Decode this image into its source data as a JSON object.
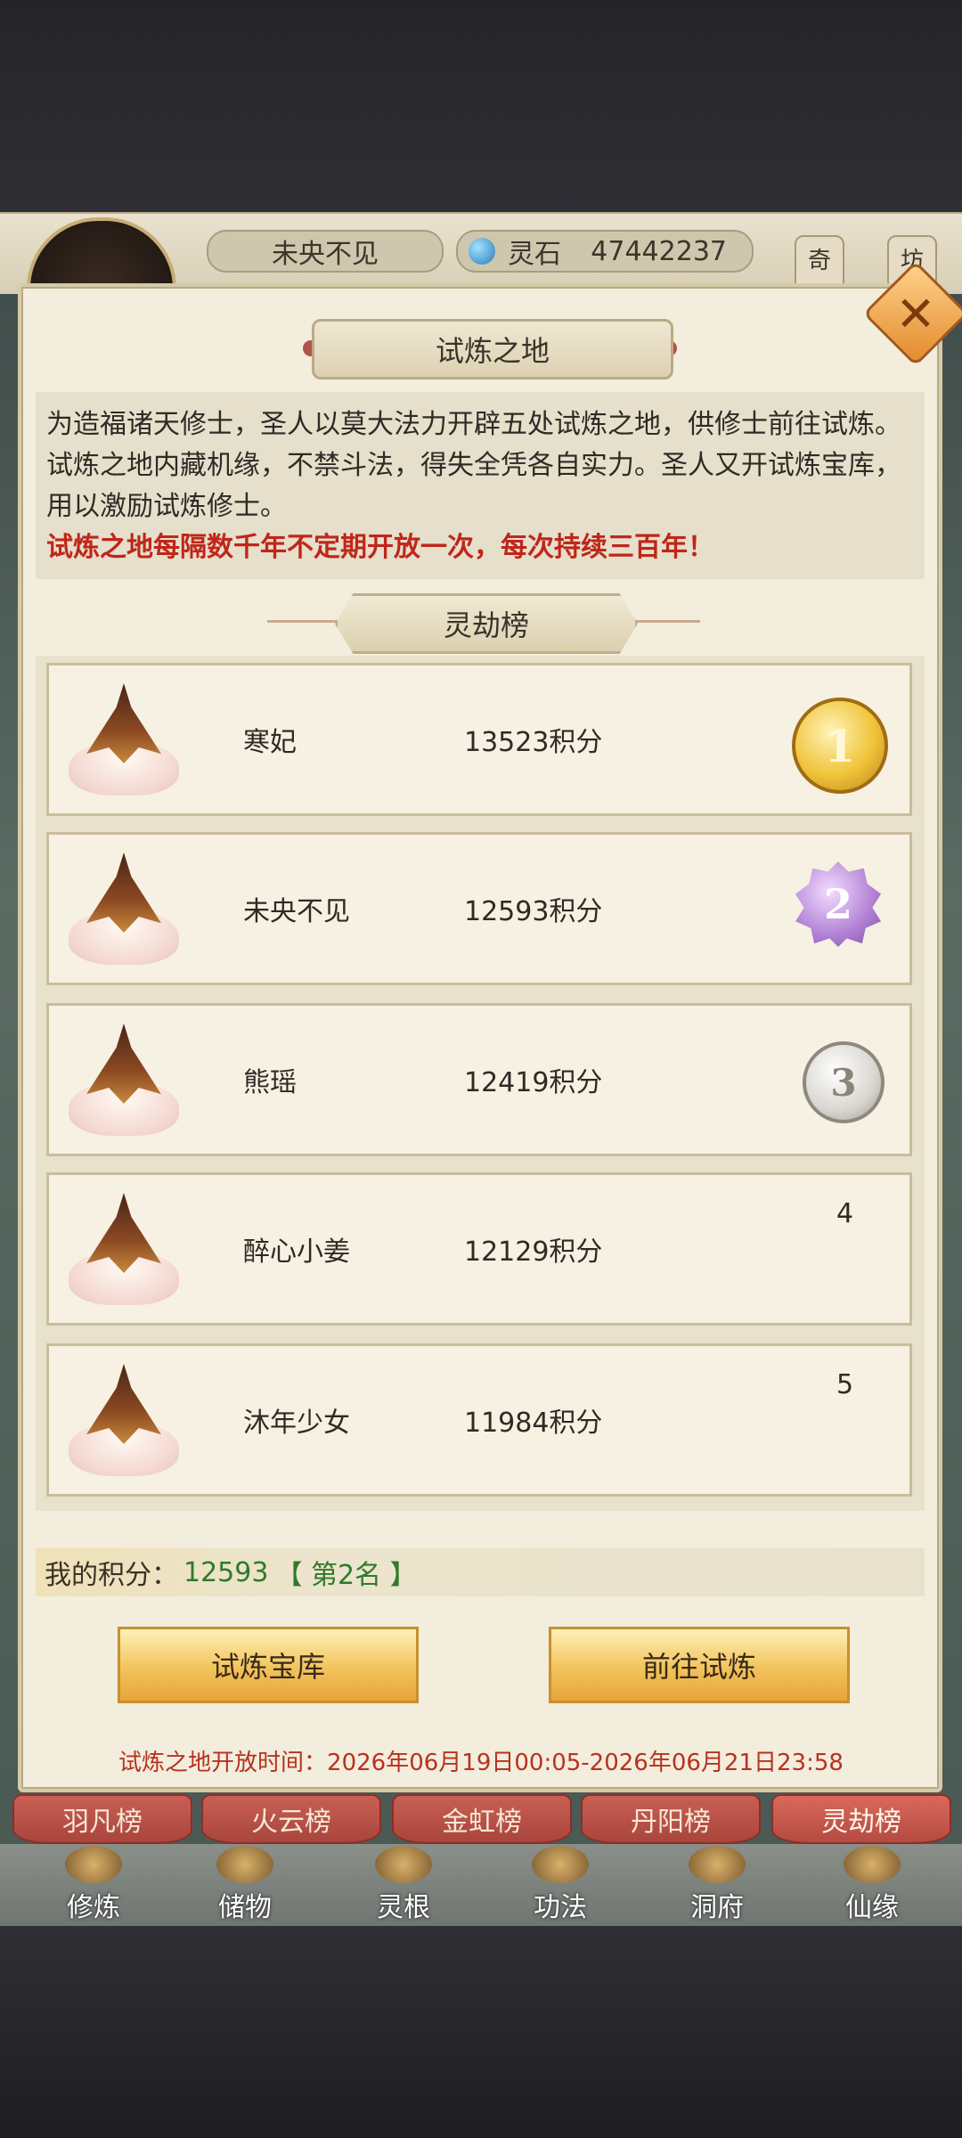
{
  "header": {
    "player_name": "未央不见",
    "currency_label": "灵石",
    "currency_value": "47442237",
    "side_buttons": [
      "奇",
      "坊"
    ]
  },
  "panel": {
    "title": "试炼之地",
    "description": "为造福诸天修士，圣人以莫大法力开辟五处试炼之地，供修士前往试炼。试炼之地内藏机缘，不禁斗法，得失全凭各自实力。圣人又开试炼宝库，用以激励试炼修士。",
    "warning": "试炼之地每隔数千年不定期开放一次，每次持续三百年！",
    "section_title": "灵劫榜",
    "ranking": [
      {
        "rank": "1",
        "name": "寒妃",
        "score": "13523积分"
      },
      {
        "rank": "2",
        "name": "未央不见",
        "score": "12593积分"
      },
      {
        "rank": "3",
        "name": "熊瑶",
        "score": "12419积分"
      },
      {
        "rank": "4",
        "name": "醉心小姜",
        "score": "12129积分"
      },
      {
        "rank": "5",
        "name": "沐年少女",
        "score": "11984积分"
      }
    ],
    "my_score_label": "我的积分：",
    "my_score_value": "12593",
    "my_rank": "【 第2名 】",
    "buttons": {
      "treasury": "试炼宝库",
      "go": "前往试炼"
    },
    "open_time": "试炼之地开放时间：2026年06月19日00:05-2026年06月21日23:58"
  },
  "tabs": [
    "羽凡榜",
    "火云榜",
    "金虹榜",
    "丹阳榜",
    "灵劫榜"
  ],
  "active_tab": "灵劫榜",
  "nav": [
    "修炼",
    "储物",
    "灵根",
    "功法",
    "洞府",
    "仙缘"
  ],
  "colors": {
    "warning": "#c0261a",
    "my_score": "#2f7a2c",
    "button": "#f2c35c",
    "tab": "#a9453c"
  }
}
